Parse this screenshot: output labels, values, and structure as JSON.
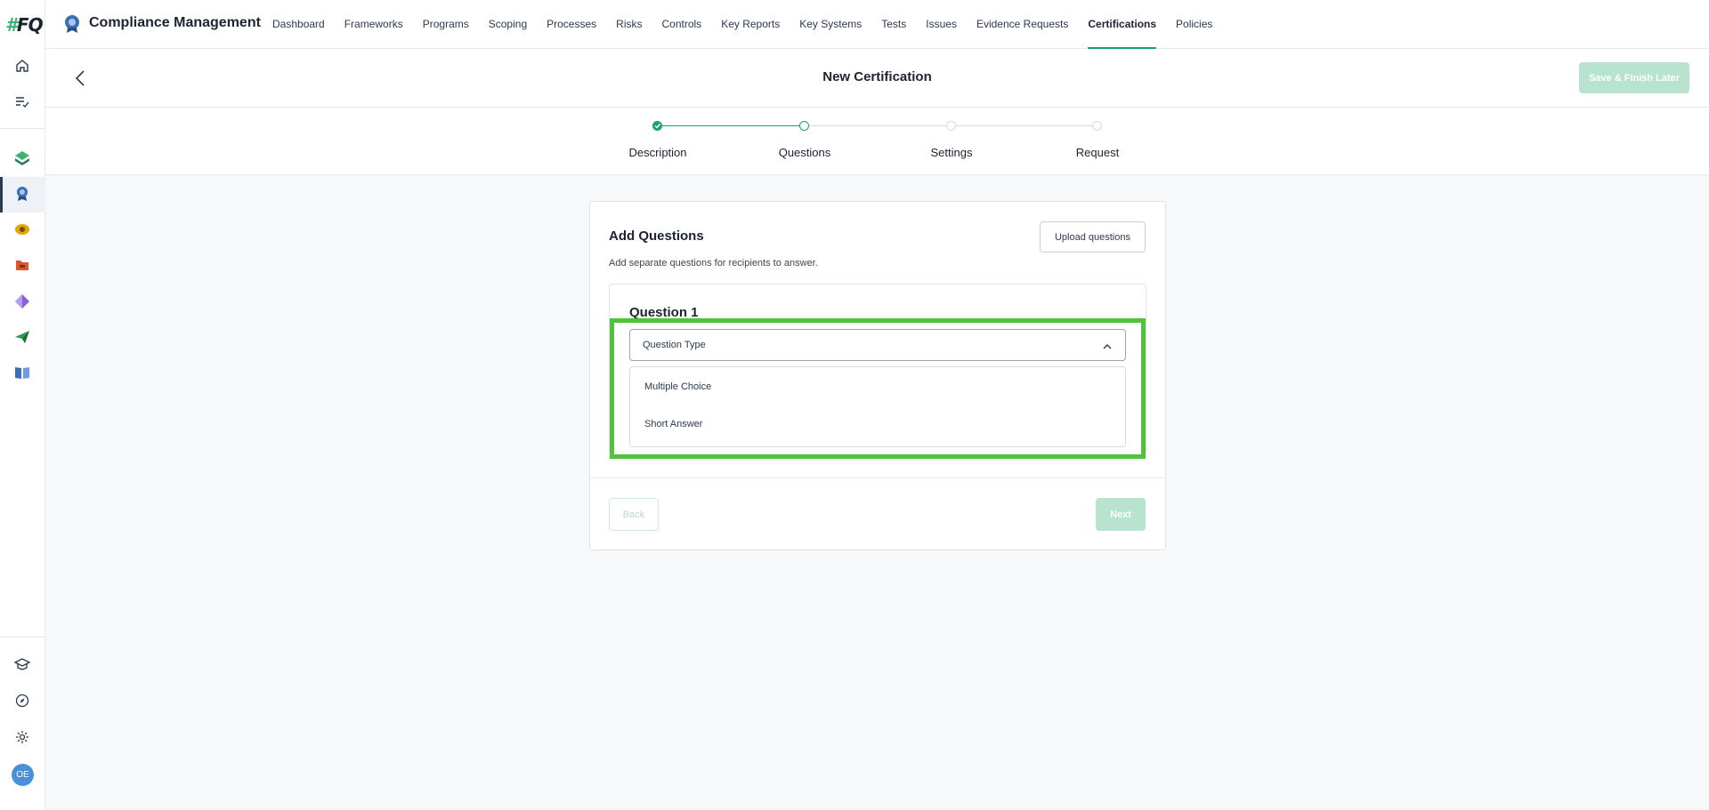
{
  "app": {
    "logo_text_hash": "#",
    "logo_text": "FQ",
    "title": "Compliance Management"
  },
  "nav": {
    "items": [
      {
        "label": "Dashboard"
      },
      {
        "label": "Frameworks"
      },
      {
        "label": "Programs"
      },
      {
        "label": "Scoping"
      },
      {
        "label": "Processes"
      },
      {
        "label": "Risks"
      },
      {
        "label": "Controls"
      },
      {
        "label": "Key Reports"
      },
      {
        "label": "Key Systems"
      },
      {
        "label": "Tests"
      },
      {
        "label": "Issues"
      },
      {
        "label": "Evidence Requests"
      },
      {
        "label": "Certifications"
      },
      {
        "label": "Policies"
      }
    ],
    "active": "Certifications"
  },
  "rail": {
    "icons": [
      "home-icon",
      "task-list-icon",
      "compliance-stack-icon",
      "certification-badge-icon",
      "eye-ring-icon",
      "folder-icon",
      "diamond-icon",
      "paper-plane-icon",
      "book-icon"
    ],
    "bottom_icons": [
      "learning-cap-icon",
      "compass-icon",
      "gear-icon"
    ],
    "avatar_initials": "OE",
    "active_index": 3
  },
  "header": {
    "title": "New Certification",
    "save_label": "Save & Finish Later"
  },
  "stepper": {
    "steps": [
      {
        "label": "Description",
        "state": "done"
      },
      {
        "label": "Questions",
        "state": "current"
      },
      {
        "label": "Settings",
        "state": "todo"
      },
      {
        "label": "Request",
        "state": "todo"
      }
    ]
  },
  "card": {
    "title": "Add Questions",
    "subtitle": "Add separate questions for recipients to answer.",
    "upload_label": "Upload questions",
    "question_title": "Question 1",
    "select_label": "Question Type",
    "options": [
      "Multiple Choice",
      "Short Answer"
    ],
    "back_label": "Back",
    "next_label": "Next"
  },
  "colors": {
    "accent": "#1aa36f",
    "disabled_accent": "#b7e3cf",
    "highlight": "#50c23c"
  }
}
